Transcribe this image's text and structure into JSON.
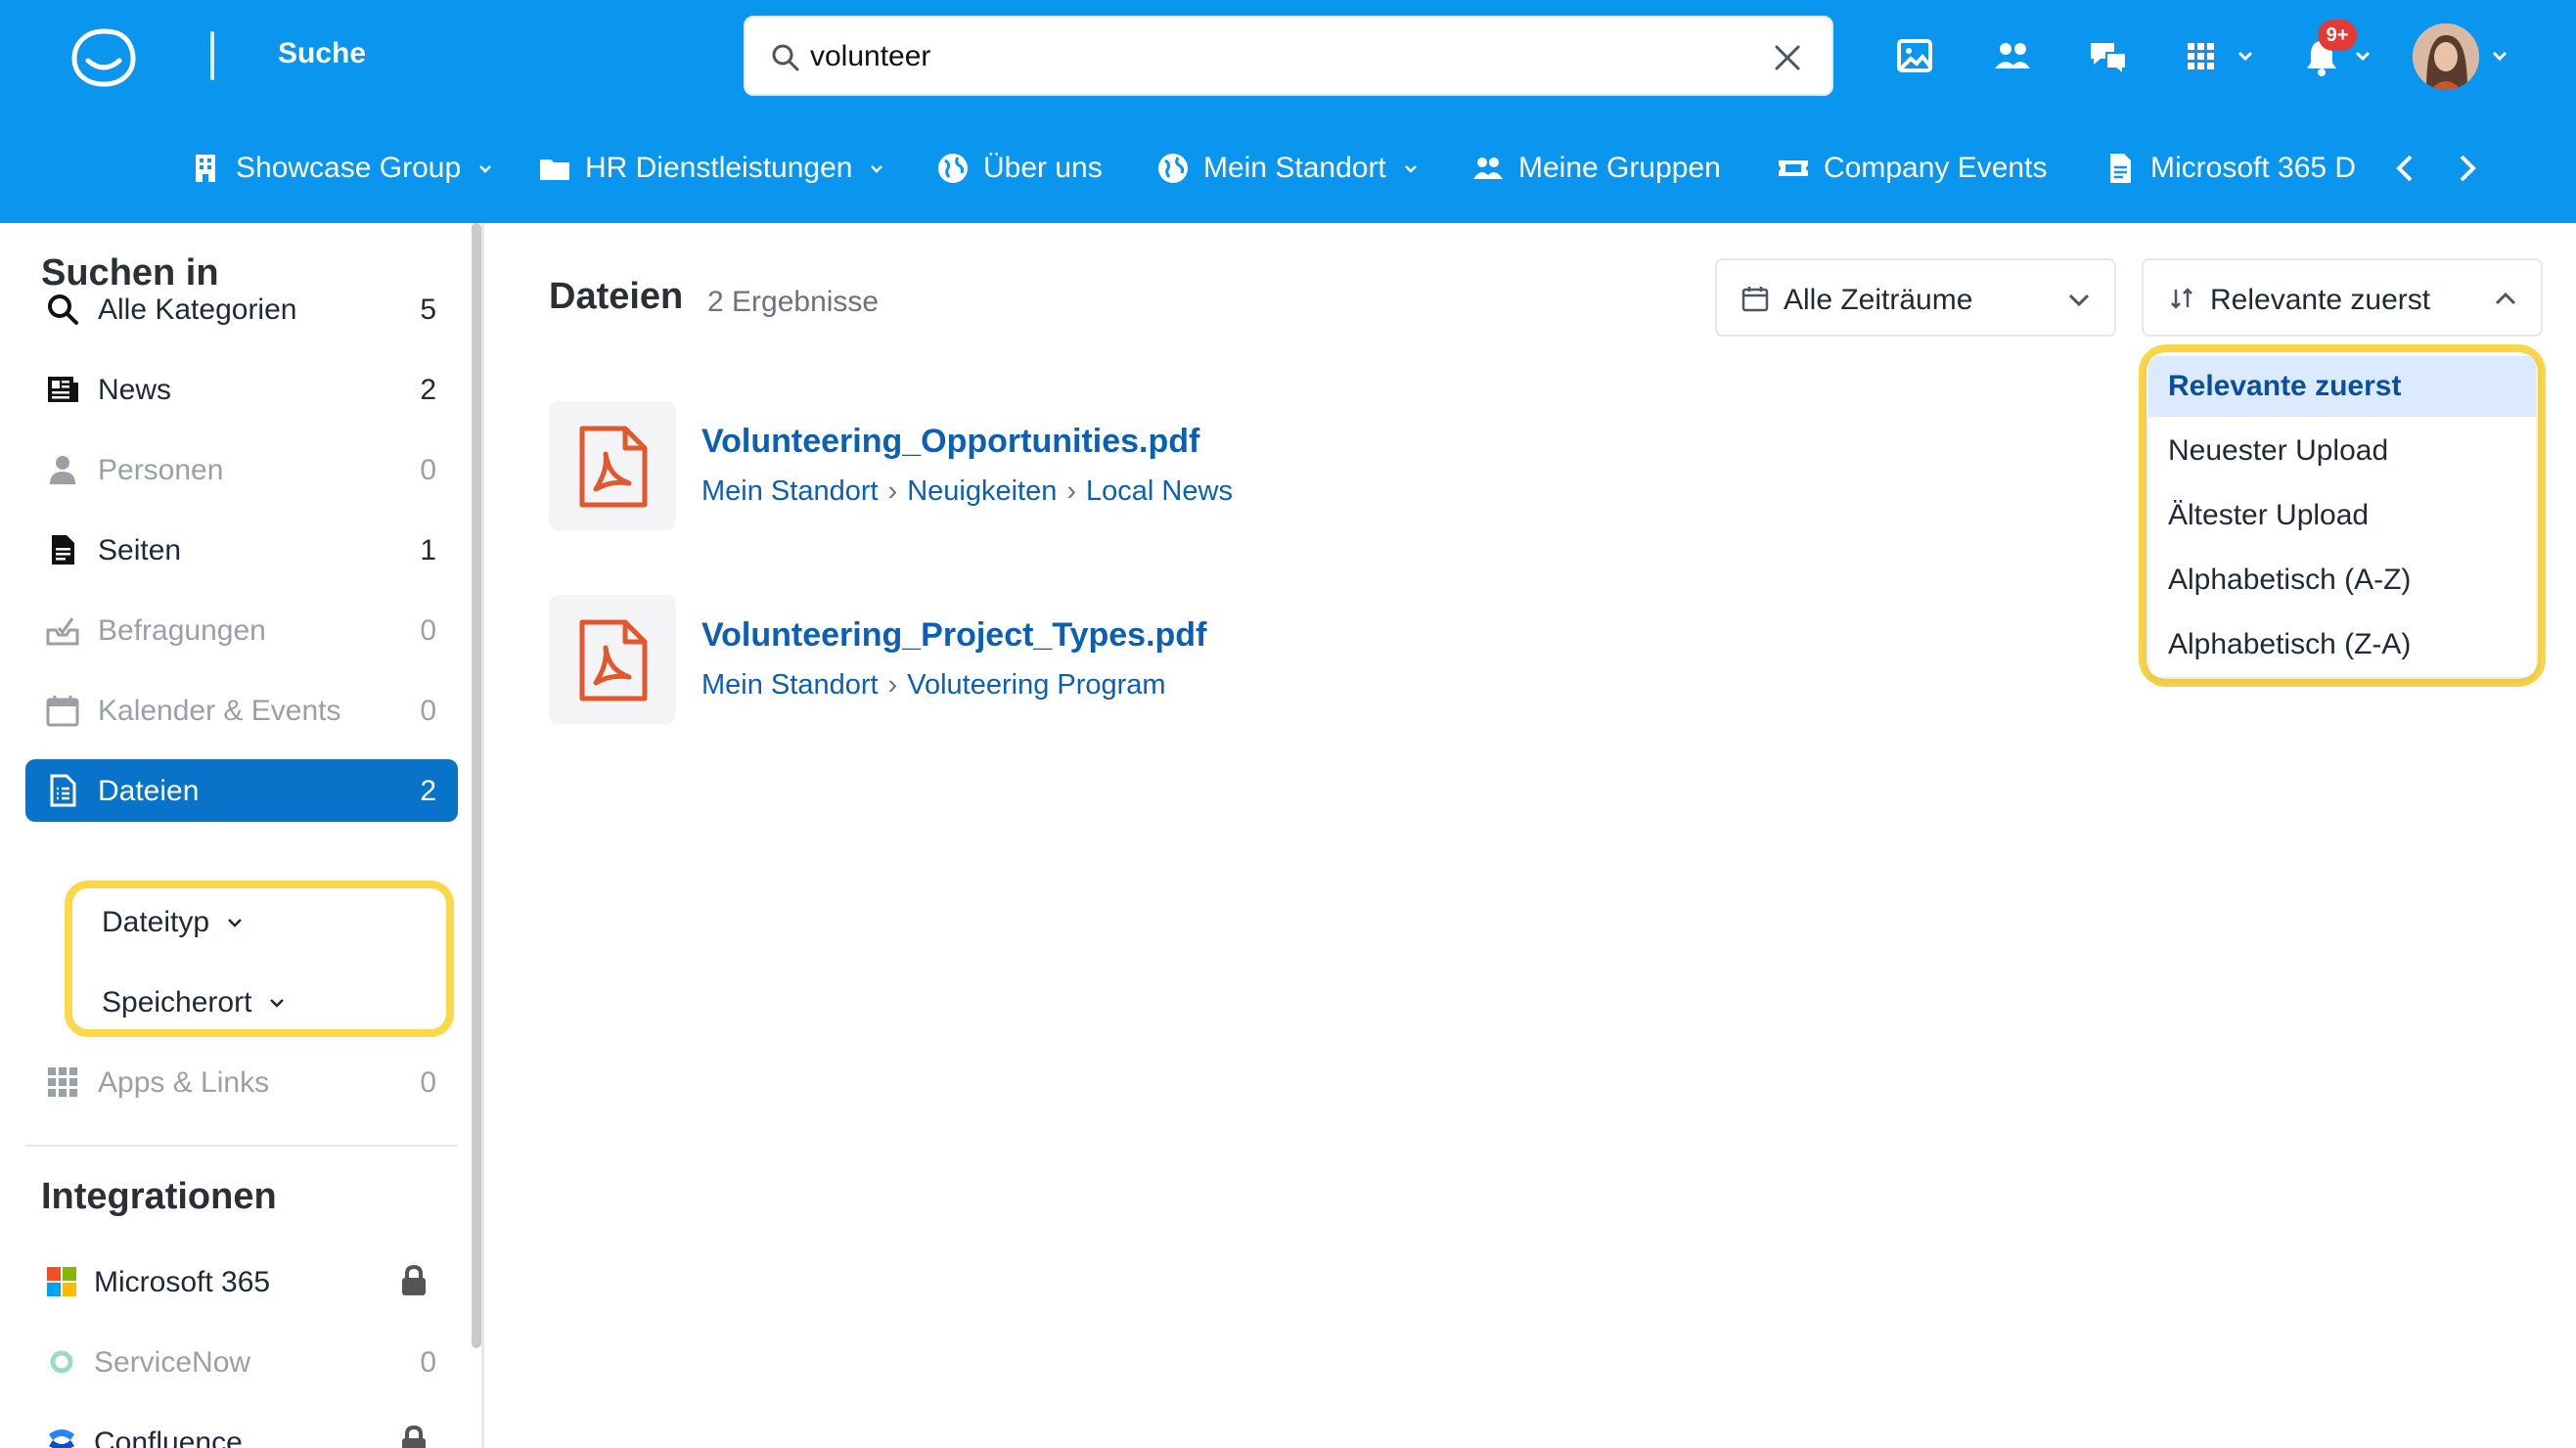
{
  "header": {
    "app_title": "Suche",
    "search": {
      "value": "volunteer",
      "placeholder": ""
    },
    "notification_badge": "9+",
    "icons": [
      "gallery-icon",
      "people-icon",
      "chat-icon",
      "apps-grid-icon",
      "bell-icon",
      "avatar"
    ]
  },
  "nav": {
    "items": [
      {
        "label": "Showcase Group",
        "icon": "building-icon",
        "dropdown": true
      },
      {
        "label": "HR Dienstleistungen",
        "icon": "folder-icon",
        "dropdown": true
      },
      {
        "label": "Über uns",
        "icon": "globe-icon",
        "dropdown": false
      },
      {
        "label": "Mein Standort",
        "icon": "globe-icon",
        "dropdown": true
      },
      {
        "label": "Meine Gruppen",
        "icon": "people-icon",
        "dropdown": false
      },
      {
        "label": "Company Events",
        "icon": "ticket-icon",
        "dropdown": false
      },
      {
        "label": "Microsoft 365 D",
        "icon": "document-icon",
        "dropdown": false
      }
    ]
  },
  "sidebar": {
    "search_in_title": "Suchen in",
    "categories": [
      {
        "label": "Alle Kategorien",
        "count": "5",
        "icon": "search-icon",
        "muted": false,
        "active": false
      },
      {
        "label": "News",
        "count": "2",
        "icon": "newspaper-icon",
        "muted": false,
        "active": false
      },
      {
        "label": "Personen",
        "count": "0",
        "icon": "person-icon",
        "muted": true,
        "active": false
      },
      {
        "label": "Seiten",
        "count": "1",
        "icon": "page-icon",
        "muted": false,
        "active": false
      },
      {
        "label": "Befragungen",
        "count": "0",
        "icon": "survey-icon",
        "muted": true,
        "active": false
      },
      {
        "label": "Kalender & Events",
        "count": "0",
        "icon": "calendar-icon",
        "muted": true,
        "active": false
      },
      {
        "label": "Dateien",
        "count": "2",
        "icon": "file-icon",
        "muted": false,
        "active": true
      },
      {
        "label": "Apps & Links",
        "count": "0",
        "icon": "apps-grid-icon",
        "muted": true,
        "active": false
      }
    ],
    "filters": [
      {
        "label": "Dateityp"
      },
      {
        "label": "Speicherort"
      }
    ],
    "integrations_title": "Integrationen",
    "integrations": [
      {
        "label": "Microsoft 365",
        "count": "",
        "locked": true,
        "muted": false
      },
      {
        "label": "ServiceNow",
        "count": "0",
        "locked": false,
        "muted": true
      },
      {
        "label": "Confluence",
        "count": "",
        "locked": true,
        "muted": false
      }
    ]
  },
  "main": {
    "title": "Dateien",
    "result_count": "2 Ergebnisse",
    "time_filter": "Alle Zeiträume",
    "sort": {
      "selected": "Relevante zuerst",
      "options": [
        "Relevante zuerst",
        "Neuester Upload",
        "Ältester Upload",
        "Alphabetisch (A-Z)",
        "Alphabetisch (Z-A)"
      ]
    },
    "files": [
      {
        "name": "Volunteering_Opportunities.pdf",
        "path": [
          "Mein Standort",
          "Neuigkeiten",
          "Local News"
        ]
      },
      {
        "name": "Volunteering_Project_Types.pdf",
        "path": [
          "Mein Standort",
          "Voluteering Program"
        ]
      }
    ],
    "breadcrumb_separator": "›"
  },
  "colors": {
    "header_bg": "#0a96ef",
    "active_item_bg": "#0873c9",
    "link": "#0b5fb4",
    "highlight_outline": "#fbd74a",
    "pdf_icon": "#e2572b",
    "badge": "#e53935"
  }
}
